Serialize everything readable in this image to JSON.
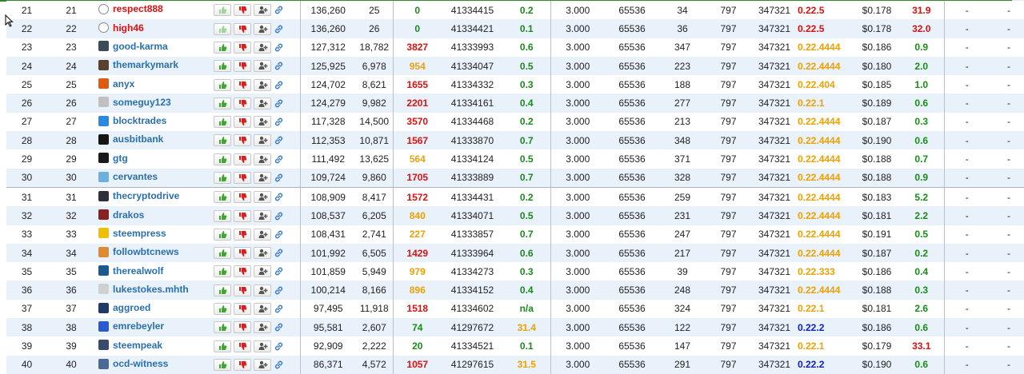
{
  "rows": [
    {
      "rank": "21",
      "rank2": "21",
      "name": "respect888",
      "avatar": "ghost-icon",
      "avcolor": "#ffffff",
      "disabled": true,
      "votes": "136,260",
      "voters": "25",
      "missed": "0",
      "missed_color": "green",
      "last_block": "41334415",
      "ms": "0.2",
      "ms_color": "green",
      "hardfork": "3.000",
      "size": "65536",
      "v1": "34",
      "v2": "797",
      "v3": "347321",
      "version": "0.22.5",
      "version_color": "red",
      "price": "$0.178",
      "feed": "31.9",
      "feed_color": "red",
      "d1": "-",
      "d2": "-"
    },
    {
      "rank": "22",
      "rank2": "22",
      "name": "high46",
      "avatar": "ghost-icon",
      "avcolor": "#ffffff",
      "disabled": true,
      "votes": "136,260",
      "voters": "26",
      "missed": "0",
      "missed_color": "green",
      "last_block": "41334421",
      "ms": "0.1",
      "ms_color": "green",
      "hardfork": "3.000",
      "size": "65536",
      "v1": "36",
      "v2": "797",
      "v3": "347321",
      "version": "0.22.5",
      "version_color": "red",
      "price": "$0.178",
      "feed": "32.0",
      "feed_color": "red",
      "d1": "-",
      "d2": "-"
    },
    {
      "rank": "23",
      "rank2": "23",
      "name": "good-karma",
      "avatar": "avatar-icon",
      "avcolor": "#3a4a5a",
      "disabled": false,
      "votes": "127,312",
      "voters": "18,782",
      "missed": "3827",
      "missed_color": "red",
      "last_block": "41333993",
      "ms": "0.6",
      "ms_color": "green",
      "hardfork": "3.000",
      "size": "65536",
      "v1": "347",
      "v2": "797",
      "v3": "347321",
      "version": "0.22.4444",
      "version_color": "orange",
      "price": "$0.186",
      "feed": "0.9",
      "feed_color": "green",
      "d1": "-",
      "d2": "-"
    },
    {
      "rank": "24",
      "rank2": "24",
      "name": "themarkymark",
      "avatar": "avatar-icon",
      "avcolor": "#5a4030",
      "disabled": false,
      "votes": "125,925",
      "voters": "6,978",
      "missed": "954",
      "missed_color": "orange",
      "last_block": "41334047",
      "ms": "0.5",
      "ms_color": "green",
      "hardfork": "3.000",
      "size": "65536",
      "v1": "223",
      "v2": "797",
      "v3": "347321",
      "version": "0.22.4444",
      "version_color": "orange",
      "price": "$0.180",
      "feed": "2.0",
      "feed_color": "green",
      "d1": "-",
      "d2": "-"
    },
    {
      "rank": "25",
      "rank2": "25",
      "name": "anyx",
      "avatar": "avatar-icon",
      "avcolor": "#e05a10",
      "disabled": false,
      "votes": "124,702",
      "voters": "8,621",
      "missed": "1655",
      "missed_color": "red",
      "last_block": "41334332",
      "ms": "0.3",
      "ms_color": "green",
      "hardfork": "3.000",
      "size": "65536",
      "v1": "188",
      "v2": "797",
      "v3": "347321",
      "version": "0.22.404",
      "version_color": "orange",
      "price": "$0.185",
      "feed": "1.0",
      "feed_color": "green",
      "d1": "-",
      "d2": "-"
    },
    {
      "rank": "26",
      "rank2": "26",
      "name": "someguy123",
      "avatar": "avatar-icon",
      "avcolor": "#c0c0c0",
      "disabled": false,
      "votes": "124,279",
      "voters": "9,982",
      "missed": "2201",
      "missed_color": "red",
      "last_block": "41334161",
      "ms": "0.4",
      "ms_color": "green",
      "hardfork": "3.000",
      "size": "65536",
      "v1": "277",
      "v2": "797",
      "v3": "347321",
      "version": "0.22.1",
      "version_color": "orange",
      "price": "$0.189",
      "feed": "0.6",
      "feed_color": "green",
      "d1": "-",
      "d2": "-"
    },
    {
      "rank": "27",
      "rank2": "27",
      "name": "blocktrades",
      "avatar": "avatar-icon",
      "avcolor": "#2a8ae0",
      "disabled": false,
      "votes": "117,328",
      "voters": "14,500",
      "missed": "3570",
      "missed_color": "red",
      "last_block": "41334468",
      "ms": "0.2",
      "ms_color": "green",
      "hardfork": "3.000",
      "size": "65536",
      "v1": "213",
      "v2": "797",
      "v3": "347321",
      "version": "0.22.4444",
      "version_color": "orange",
      "price": "$0.187",
      "feed": "0.3",
      "feed_color": "green",
      "d1": "-",
      "d2": "-"
    },
    {
      "rank": "28",
      "rank2": "28",
      "name": "ausbitbank",
      "avatar": "avatar-icon",
      "avcolor": "#151515",
      "disabled": false,
      "votes": "112,353",
      "voters": "10,871",
      "missed": "1567",
      "missed_color": "red",
      "last_block": "41333870",
      "ms": "0.7",
      "ms_color": "green",
      "hardfork": "3.000",
      "size": "65536",
      "v1": "348",
      "v2": "797",
      "v3": "347321",
      "version": "0.22.4444",
      "version_color": "orange",
      "price": "$0.190",
      "feed": "0.6",
      "feed_color": "green",
      "d1": "-",
      "d2": "-"
    },
    {
      "rank": "29",
      "rank2": "29",
      "name": "gtg",
      "avatar": "avatar-icon",
      "avcolor": "#1a1a1a",
      "disabled": false,
      "votes": "111,492",
      "voters": "13,625",
      "missed": "564",
      "missed_color": "orange",
      "last_block": "41334124",
      "ms": "0.5",
      "ms_color": "green",
      "hardfork": "3.000",
      "size": "65536",
      "v1": "371",
      "v2": "797",
      "v3": "347321",
      "version": "0.22.4444",
      "version_color": "orange",
      "price": "$0.188",
      "feed": "0.7",
      "feed_color": "green",
      "d1": "-",
      "d2": "-"
    },
    {
      "rank": "30",
      "rank2": "30",
      "name": "cervantes",
      "avatar": "avatar-icon",
      "avcolor": "#6ab0e0",
      "disabled": false,
      "votes": "109,724",
      "voters": "9,860",
      "missed": "1705",
      "missed_color": "red",
      "last_block": "41333889",
      "ms": "0.7",
      "ms_color": "green",
      "hardfork": "3.000",
      "size": "65536",
      "v1": "328",
      "v2": "797",
      "v3": "347321",
      "version": "0.22.4444",
      "version_color": "orange",
      "price": "$0.188",
      "feed": "0.9",
      "feed_color": "green",
      "d1": "-",
      "d2": "-"
    },
    {
      "rank": "31",
      "rank2": "31",
      "name": "thecryptodrive",
      "avatar": "avatar-icon",
      "avcolor": "#30303a",
      "disabled": false,
      "votes": "108,909",
      "voters": "8,417",
      "missed": "1572",
      "missed_color": "red",
      "last_block": "41334431",
      "ms": "0.2",
      "ms_color": "green",
      "hardfork": "3.000",
      "size": "65536",
      "v1": "259",
      "v2": "797",
      "v3": "347321",
      "version": "0.22.4444",
      "version_color": "orange",
      "price": "$0.183",
      "feed": "5.2",
      "feed_color": "green",
      "d1": "-",
      "d2": "-"
    },
    {
      "rank": "32",
      "rank2": "32",
      "name": "drakos",
      "avatar": "avatar-icon",
      "avcolor": "#8a2020",
      "disabled": false,
      "votes": "108,537",
      "voters": "6,205",
      "missed": "840",
      "missed_color": "orange",
      "last_block": "41334071",
      "ms": "0.5",
      "ms_color": "green",
      "hardfork": "3.000",
      "size": "65536",
      "v1": "231",
      "v2": "797",
      "v3": "347321",
      "version": "0.22.4444",
      "version_color": "orange",
      "price": "$0.181",
      "feed": "2.2",
      "feed_color": "green",
      "d1": "-",
      "d2": "-"
    },
    {
      "rank": "33",
      "rank2": "33",
      "name": "steempress",
      "avatar": "avatar-icon",
      "avcolor": "#f0c000",
      "disabled": false,
      "votes": "108,431",
      "voters": "2,741",
      "missed": "227",
      "missed_color": "orange",
      "last_block": "41333857",
      "ms": "0.7",
      "ms_color": "green",
      "hardfork": "3.000",
      "size": "65536",
      "v1": "247",
      "v2": "797",
      "v3": "347321",
      "version": "0.22.4444",
      "version_color": "orange",
      "price": "$0.191",
      "feed": "0.5",
      "feed_color": "green",
      "d1": "-",
      "d2": "-"
    },
    {
      "rank": "34",
      "rank2": "34",
      "name": "followbtcnews",
      "avatar": "avatar-icon",
      "avcolor": "#e08a30",
      "disabled": false,
      "votes": "101,992",
      "voters": "6,505",
      "missed": "1429",
      "missed_color": "red",
      "last_block": "41333964",
      "ms": "0.6",
      "ms_color": "green",
      "hardfork": "3.000",
      "size": "65536",
      "v1": "217",
      "v2": "797",
      "v3": "347321",
      "version": "0.22.4444",
      "version_color": "orange",
      "price": "$0.187",
      "feed": "0.2",
      "feed_color": "green",
      "d1": "-",
      "d2": "-"
    },
    {
      "rank": "35",
      "rank2": "35",
      "name": "therealwolf",
      "avatar": "avatar-icon",
      "avcolor": "#1a5a90",
      "disabled": false,
      "votes": "101,859",
      "voters": "5,949",
      "missed": "979",
      "missed_color": "orange",
      "last_block": "41334273",
      "ms": "0.3",
      "ms_color": "green",
      "hardfork": "3.000",
      "size": "65536",
      "v1": "39",
      "v2": "797",
      "v3": "347321",
      "version": "0.22.333",
      "version_color": "orange",
      "price": "$0.186",
      "feed": "0.4",
      "feed_color": "green",
      "d1": "-",
      "d2": "-"
    },
    {
      "rank": "36",
      "rank2": "36",
      "name": "lukestokes.mhth",
      "avatar": "avatar-icon",
      "avcolor": "#d0d0d0",
      "disabled": false,
      "votes": "100,214",
      "voters": "8,166",
      "missed": "896",
      "missed_color": "orange",
      "last_block": "41334152",
      "ms": "0.4",
      "ms_color": "green",
      "hardfork": "3.000",
      "size": "65536",
      "v1": "248",
      "v2": "797",
      "v3": "347321",
      "version": "0.22.4444",
      "version_color": "orange",
      "price": "$0.188",
      "feed": "0.3",
      "feed_color": "green",
      "d1": "-",
      "d2": "-"
    },
    {
      "rank": "37",
      "rank2": "37",
      "name": "aggroed",
      "avatar": "avatar-icon",
      "avcolor": "#203a6a",
      "disabled": false,
      "votes": "97,495",
      "voters": "11,918",
      "missed": "1518",
      "missed_color": "red",
      "last_block": "41334602",
      "ms": "n/a",
      "ms_color": "green",
      "hardfork": "3.000",
      "size": "65536",
      "v1": "324",
      "v2": "797",
      "v3": "347321",
      "version": "0.22.1",
      "version_color": "orange",
      "price": "$0.181",
      "feed": "2.6",
      "feed_color": "green",
      "d1": "-",
      "d2": "-"
    },
    {
      "rank": "38",
      "rank2": "38",
      "name": "emrebeyler",
      "avatar": "avatar-icon",
      "avcolor": "#2a5ad0",
      "disabled": false,
      "votes": "95,581",
      "voters": "2,607",
      "missed": "74",
      "missed_color": "green",
      "last_block": "41297672",
      "ms": "31.4",
      "ms_color": "orange",
      "hardfork": "3.000",
      "size": "65536",
      "v1": "122",
      "v2": "797",
      "v3": "347321",
      "version": "0.22.2",
      "version_color": "blue",
      "price": "$0.186",
      "feed": "0.6",
      "feed_color": "green",
      "d1": "-",
      "d2": "-"
    },
    {
      "rank": "39",
      "rank2": "39",
      "name": "steempeak",
      "avatar": "avatar-icon",
      "avcolor": "#3a4a6a",
      "disabled": false,
      "votes": "92,909",
      "voters": "2,222",
      "missed": "20",
      "missed_color": "green",
      "last_block": "41334521",
      "ms": "0.1",
      "ms_color": "green",
      "hardfork": "3.000",
      "size": "65536",
      "v1": "147",
      "v2": "797",
      "v3": "347321",
      "version": "0.22.1",
      "version_color": "orange",
      "price": "$0.179",
      "feed": "33.1",
      "feed_color": "red",
      "d1": "-",
      "d2": "-"
    },
    {
      "rank": "40",
      "rank2": "40",
      "name": "ocd-witness",
      "avatar": "avatar-icon",
      "avcolor": "#4a6a9a",
      "disabled": false,
      "votes": "86,371",
      "voters": "4,572",
      "missed": "1057",
      "missed_color": "red",
      "last_block": "41297615",
      "ms": "31.5",
      "ms_color": "orange",
      "hardfork": "3.000",
      "size": "65536",
      "v1": "291",
      "v2": "797",
      "v3": "347321",
      "version": "0.22.2",
      "version_color": "blue",
      "price": "$0.190",
      "feed": "0.6",
      "feed_color": "green",
      "d1": "-",
      "d2": "-"
    }
  ],
  "icons": {
    "upvote": "thumbs-up-icon",
    "downvote": "thumbs-down-icon",
    "proxy": "add-user-icon",
    "link": "link-icon"
  },
  "colors": {
    "red": "#e01010",
    "orange": "#f0a000",
    "green": "#1a8a1a",
    "blue": "#1020c8",
    "name": "#2a6fb0",
    "row_alt": "#e9f1fb"
  }
}
